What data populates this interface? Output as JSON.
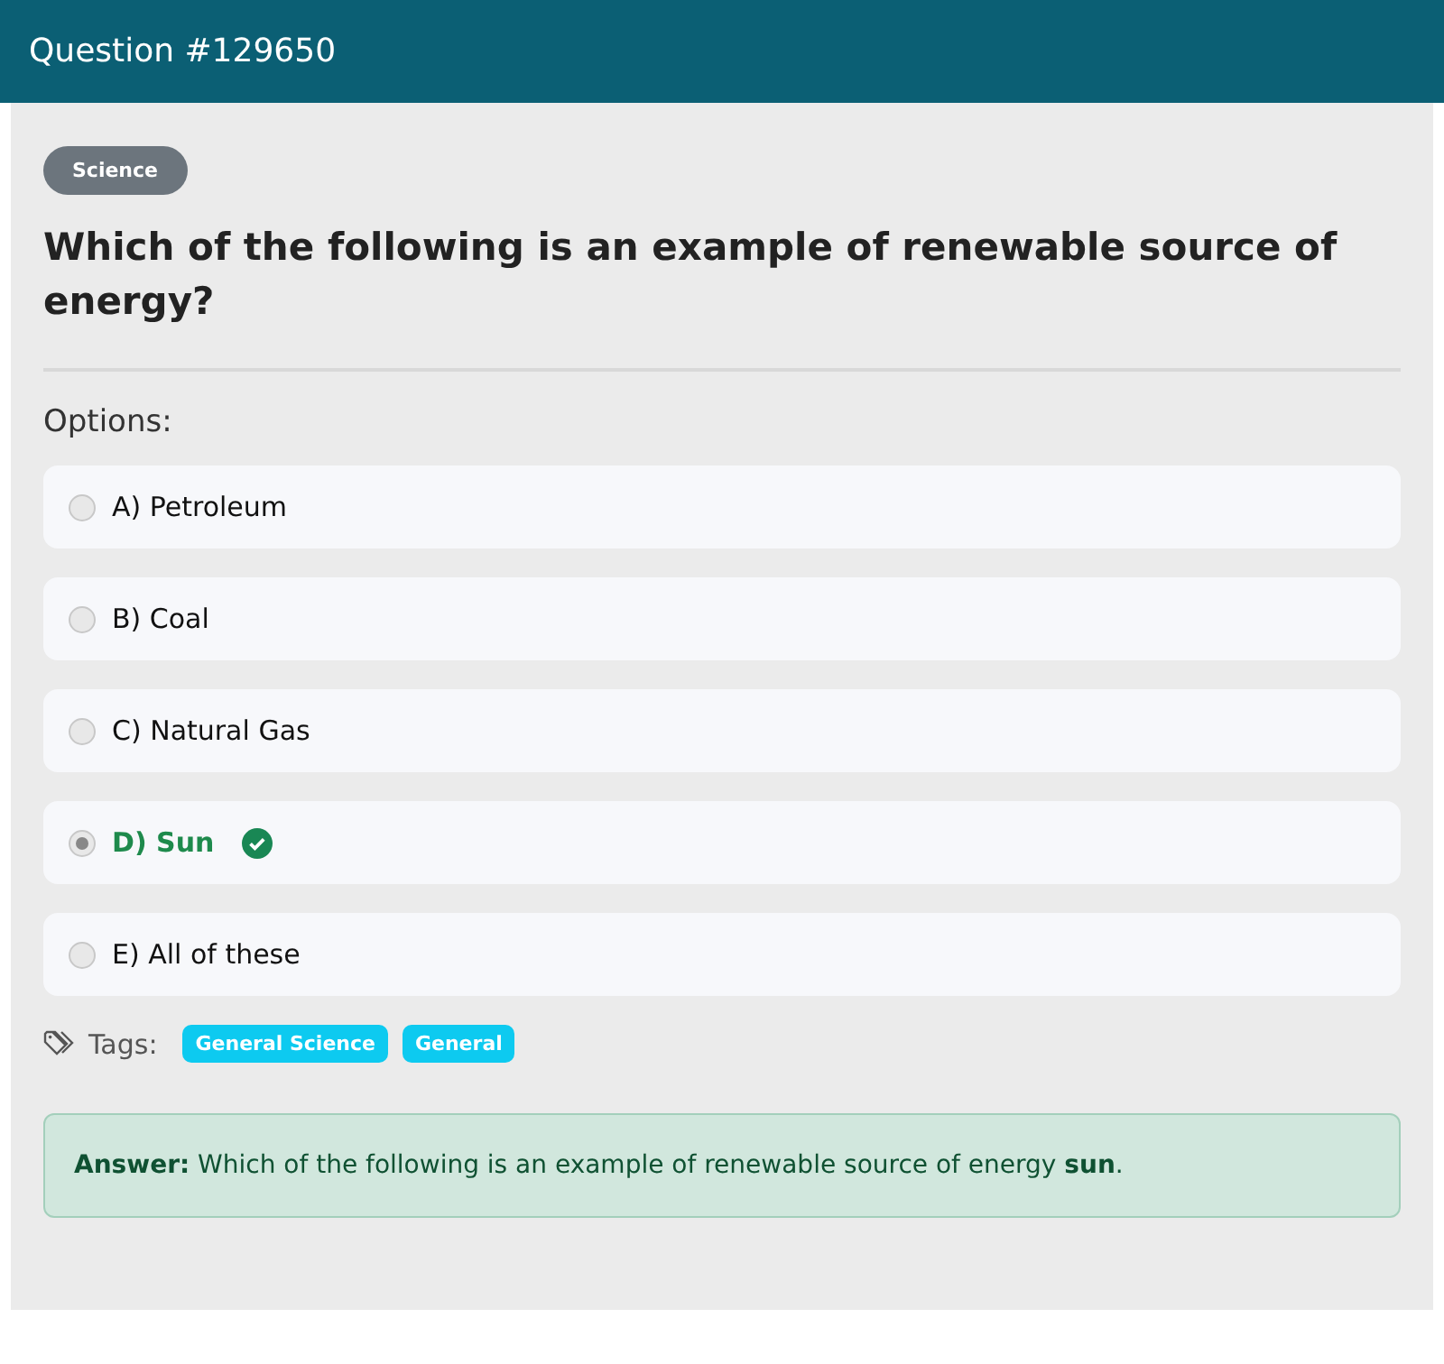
{
  "header": {
    "title": "Question #129650"
  },
  "category": "Science",
  "question": "Which of the following is an example of renewable source of energy?",
  "options_label": "Options:",
  "options": [
    {
      "label": "A) Petroleum",
      "selected": false,
      "correct": false
    },
    {
      "label": "B) Coal",
      "selected": false,
      "correct": false
    },
    {
      "label": "C) Natural Gas",
      "selected": false,
      "correct": false
    },
    {
      "label": "D) Sun",
      "selected": true,
      "correct": true
    },
    {
      "label": "E) All of these",
      "selected": false,
      "correct": false
    }
  ],
  "tags_label": "Tags:",
  "tags": [
    "General Science",
    "General"
  ],
  "answer": "**Answer:** Which of the following is an example of renewable source of energy **sun**."
}
